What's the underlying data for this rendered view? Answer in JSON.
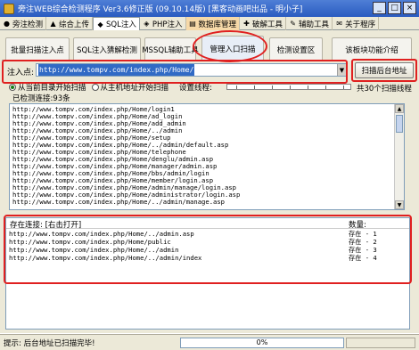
{
  "window": {
    "title": "旁注WEB综合检测程序 Ver3.6修正版 (09.10.14版) [黑客动画吧出品 - 明小子]",
    "buttons": [
      "_",
      "□",
      "×"
    ]
  },
  "top_tabs": [
    {
      "label": "旁注检测",
      "icon": "globe-icon"
    },
    {
      "label": "综合上传",
      "icon": "upload-icon"
    },
    {
      "label": "SQL注入",
      "icon": "sql-icon"
    },
    {
      "label": "PHP注入",
      "icon": "php-icon"
    },
    {
      "label": "数据库管理",
      "icon": "database-icon"
    },
    {
      "label": "破解工具",
      "icon": "crack-icon"
    },
    {
      "label": "辅助工具",
      "icon": "tools-icon"
    },
    {
      "label": "关于程序",
      "icon": "about-icon"
    }
  ],
  "sub_tabs": [
    "批量扫描注入点",
    "SQL注入猜解检测",
    "MSSQL辅助工具",
    "管理入口扫描",
    "检测设置区",
    "该板块功能介绍"
  ],
  "inject": {
    "label": "注入点:",
    "value": "http://www.tompv.com/index.php/Home/",
    "button": "扫描后台地址"
  },
  "options": {
    "radio1": "从当前目录开始扫描",
    "radio2": "从主机地址开始扫描",
    "threads_label": "设置线程:",
    "threads_value": "共30个扫描线程"
  },
  "found": {
    "label": "已检测连接:93条",
    "lines": [
      "http://www.tompv.com/index.php/Home/login1",
      "http://www.tompv.com/index.php/Home/ad_login",
      "http://www.tompv.com/index.php/Home/add_admin",
      "http://www.tompv.com/index.php/Home/../admin",
      "http://www.tompv.com/index.php/Home/setup",
      "http://www.tompv.com/index.php/Home/../admin/default.asp",
      "http://www.tompv.com/index.php/Home/telephone",
      "http://www.tompv.com/index.php/Home/denglu/admin.asp",
      "http://www.tompv.com/index.php/Home/manager/admin.asp",
      "http://www.tompv.com/index.php/Home/bbs/admin/login",
      "http://www.tompv.com/index.php/Home/member/login.asp",
      "http://www.tompv.com/index.php/Home/admin/manage/login.asp",
      "http://www.tompv.com/index.php/Home/administrator/login.asp",
      "http://www.tompv.com/index.php/Home/../admin/manage.asp"
    ]
  },
  "results": {
    "col_link": "存在连接: [右击打开]",
    "col_count": "数量:",
    "rows": [
      {
        "url": "http://www.tompv.com/index.php/Home/../admin.asp",
        "status": "存在 - 1"
      },
      {
        "url": "http://www.tompv.com/index.php/Home/public",
        "status": "存在 - 2"
      },
      {
        "url": "http://www.tompv.com/index.php/Home/../admin",
        "status": "存在 - 3"
      },
      {
        "url": "http://www.tompv.com/index.php/Home/../admin/index",
        "status": "存在 - 4"
      }
    ]
  },
  "status": {
    "text": "提示: 后台地址已扫描完毕!",
    "progress_label": "0%",
    "progress_fraction": 0.0
  },
  "colors": {
    "annotation_red": "#e02020",
    "titlebar_blue": "#2a5bc0"
  }
}
